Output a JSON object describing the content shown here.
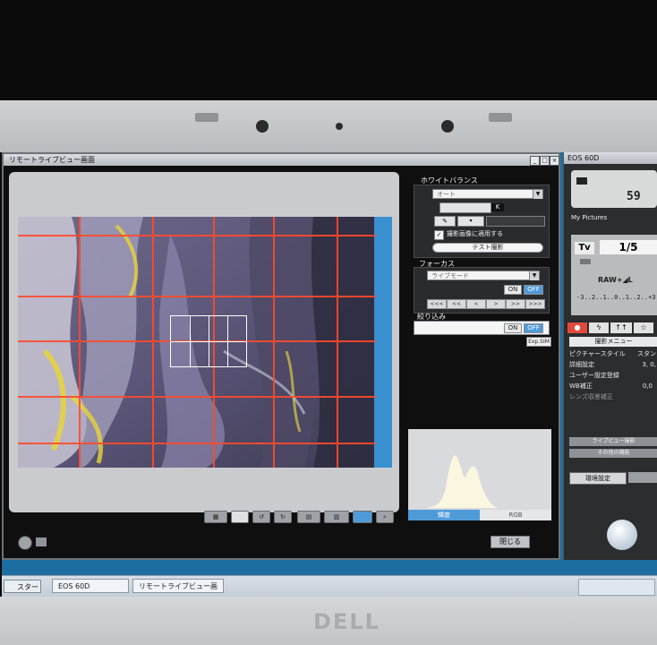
{
  "main_window": {
    "title": "リモートライブビュー画面",
    "controls": {
      "minimize": "_",
      "maximize": "□",
      "close": "×"
    }
  },
  "white_balance": {
    "label": "ホワイトバランス",
    "mode_value": "オート",
    "k_badge": "K",
    "apply_checkbox_label": "撮影画像に適用する",
    "test_shot_button": "テスト撮影"
  },
  "focus": {
    "label": "フォーカス",
    "mode_value": "ライブモード",
    "toggle_on": "ON",
    "toggle_off": "OFF",
    "steps": [
      "<<<",
      "<<",
      "<",
      ">",
      ">>",
      ">>>"
    ]
  },
  "aperture_preview": {
    "label": "絞り込み",
    "toggle_on": "ON",
    "toggle_off": "OFF",
    "exp_sim": "Exp.SIM"
  },
  "histogram": {
    "tab_luminance": "輝度",
    "tab_rgb": "RGB"
  },
  "bottom": {
    "close_button": "閉じる"
  },
  "eos_panel": {
    "title": "EOS 60D",
    "shots_remaining": "59",
    "folder": "My Pictures",
    "mode": "Tv",
    "shutter": "1/5",
    "quality": "RAW+◢L",
    "exposure_scale": "-3..2..1..0..1..2..+3",
    "menu_title": "撮影メニュー",
    "menu_rows": [
      {
        "label": "ピクチャースタイル",
        "value": "スタン"
      },
      {
        "label": "詳細設定",
        "value": "3, 0,"
      },
      {
        "label": "ユーザー設定登録",
        "value": ""
      },
      {
        "label": "WB補正",
        "value": "0,0"
      },
      {
        "label": "レンズ収差補正",
        "value": ""
      }
    ],
    "liveview_button": "ライブビュー撮影",
    "other_button": "その他の機能",
    "env_button": "環境設定"
  },
  "taskbar": {
    "start_label": "スタート",
    "items": [
      "EOS 60D",
      "リモートライブビュー画面"
    ]
  },
  "bezel_logo": "DELL",
  "colors": {
    "accent_blue": "#4f9bd8",
    "grid_line": "#ff4a2a",
    "desktop": "#1d6ea0"
  }
}
